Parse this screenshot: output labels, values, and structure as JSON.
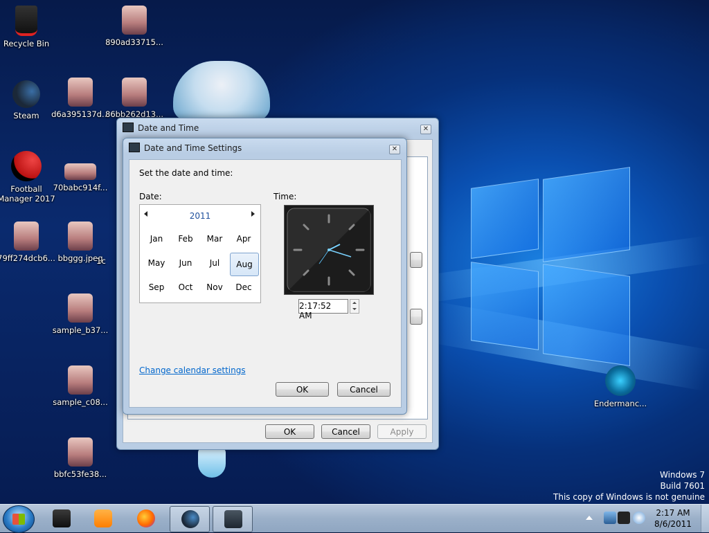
{
  "desktop": {
    "icons": [
      {
        "label": "Recycle Bin",
        "kind": "recycle-bin"
      },
      {
        "label": "890ad33715...",
        "kind": "image"
      },
      {
        "label": "Steam",
        "kind": "steam"
      },
      {
        "label": "d6a395137d...",
        "kind": "image"
      },
      {
        "label": "86bb262d13...",
        "kind": "image"
      },
      {
        "label": "Football Manager 2017",
        "kind": "app"
      },
      {
        "label": "70babc914f...",
        "kind": "image"
      },
      {
        "label": "79ff274dcb6...",
        "kind": "image"
      },
      {
        "label": "bbggg.jpeg",
        "kind": "image"
      },
      {
        "label": "1c",
        "kind": "image"
      },
      {
        "label": "sample_b37...",
        "kind": "image"
      },
      {
        "label": "sample_c08...",
        "kind": "image"
      },
      {
        "label": "bbfc53fe38...",
        "kind": "image"
      },
      {
        "label": "Endermanc...",
        "kind": "app"
      }
    ],
    "watermark": [
      "Windows 7",
      "Build 7601",
      "This copy of Windows is not genuine"
    ]
  },
  "outer_dialog": {
    "title": "Date and Time",
    "buttons": {
      "ok": "OK",
      "cancel": "Cancel",
      "apply": "Apply"
    }
  },
  "inner_dialog": {
    "title": "Date and Time Settings",
    "instruction": "Set the date and time:",
    "date_label": "Date:",
    "time_label": "Time:",
    "year": "2011",
    "months": [
      "Jan",
      "Feb",
      "Mar",
      "Apr",
      "May",
      "Jun",
      "Jul",
      "Aug",
      "Sep",
      "Oct",
      "Nov",
      "Dec"
    ],
    "selected_month": "Aug",
    "time_value": "2:17:52 AM",
    "change_calendar_link": "Change calendar settings",
    "ok": "OK",
    "cancel": "Cancel"
  },
  "taskbar": {
    "apps": [
      "media-player",
      "media-app",
      "firefox",
      "steam",
      "date-time-control-panel"
    ],
    "clock_time": "2:17 AM",
    "clock_date": "8/6/2011"
  }
}
